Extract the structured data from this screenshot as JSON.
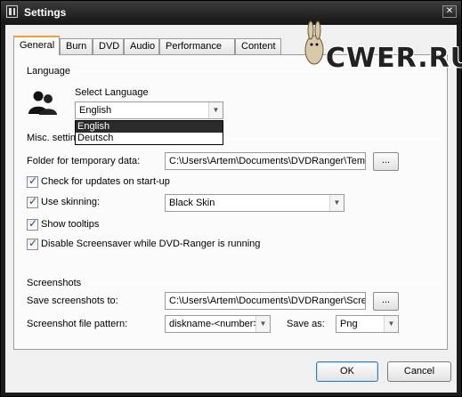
{
  "window": {
    "title": "Settings",
    "close_glyph": "✕"
  },
  "tabs": [
    {
      "label": "General",
      "active": true
    },
    {
      "label": "Burn"
    },
    {
      "label": "DVD"
    },
    {
      "label": "Audio"
    },
    {
      "label": "Performance"
    },
    {
      "label": "Content"
    }
  ],
  "language": {
    "group_label": "Language",
    "select_label": "Select Language",
    "selected": "English",
    "options": [
      "English",
      "Deutsch"
    ]
  },
  "misc": {
    "group_label": "Misc. settings",
    "temp_folder_label": "Folder for temporary data:",
    "temp_folder_value": "C:\\Users\\Artem\\Documents\\DVDRanger\\Temp",
    "browse_label": "...",
    "check_updates_label": "Check for updates on start-up",
    "check_updates_checked": true,
    "use_skinning_label": "Use skinning:",
    "use_skinning_checked": true,
    "skin_value": "Black Skin",
    "show_tooltips_label": "Show tooltips",
    "show_tooltips_checked": true,
    "disable_screensaver_label": "Disable Screensaver while DVD-Ranger is running",
    "disable_screensaver_checked": true
  },
  "screenshots": {
    "group_label": "Screenshots",
    "save_to_label": "Save screenshots to:",
    "save_to_value": "C:\\Users\\Artem\\Documents\\DVDRanger\\Screenshots",
    "browse_label": "...",
    "pattern_label": "Screenshot file pattern:",
    "pattern_value": "diskname-<number>",
    "save_as_label": "Save as:",
    "save_as_value": "Png"
  },
  "buttons": {
    "ok": "OK",
    "cancel": "Cancel"
  },
  "watermark": {
    "text": "CWER.RU"
  },
  "icons": {
    "title_icon": "app-icon",
    "language_icon": "users-icon",
    "dropdown_arrow": "▼"
  },
  "colors": {
    "title_bar": "#1c1c1c",
    "active_tab_accent": "#f0a030",
    "selection": "#2b2b2b"
  }
}
